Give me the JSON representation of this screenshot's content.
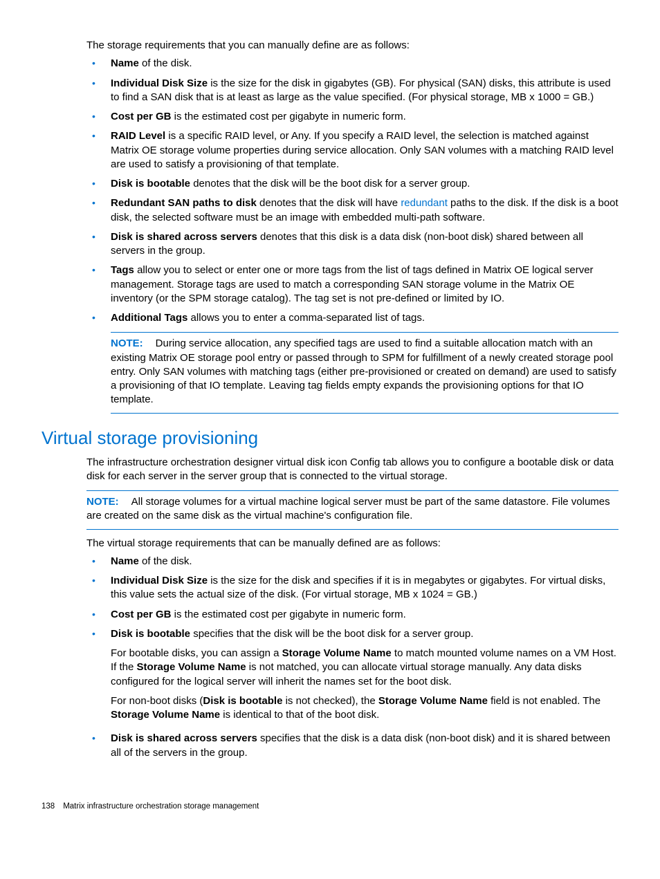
{
  "intro1": "The storage requirements that you can manually define are as follows:",
  "list1": {
    "i0_b": "Name",
    "i0_t": " of the disk.",
    "i1_b": "Individual Disk Size",
    "i1_t": " is the size for the disk in gigabytes (GB). For physical (SAN) disks, this attribute is used to find a SAN disk that is at least as large as the value specified. (For physical storage, MB x 1000 = GB.)",
    "i2_b": "Cost per GB",
    "i2_t": " is the estimated cost per gigabyte in numeric form.",
    "i3_b": "RAID Level",
    "i3_t": " is a specific RAID level, or Any. If you specify a RAID level, the selection is matched against Matrix OE storage volume properties during service allocation. Only SAN volumes with a matching RAID level are used to satisfy a provisioning of that template.",
    "i4_b": "Disk is bootable",
    "i4_t": " denotes that the disk will be the boot disk for a server group.",
    "i5_b": "Redundant SAN paths to disk",
    "i5_t1": " denotes that the disk will have ",
    "i5_link": "redundant",
    "i5_t2": " paths to the disk. If the disk is a boot disk, the selected software must be an image with embedded multi-path software.",
    "i6_b": "Disk is shared across servers",
    "i6_t": " denotes that this disk is a data disk (non-boot disk) shared between all servers in the group.",
    "i7_b": "Tags",
    "i7_t": " allow you to select or enter one or more tags from the list of tags defined in Matrix OE logical server management. Storage tags are used to match a corresponding SAN storage volume in the Matrix OE inventory (or the SPM storage catalog). The tag set is not pre-defined or limited by IO.",
    "i8_b": "Additional Tags",
    "i8_t": " allows you to enter a comma-separated list of tags."
  },
  "note1_label": "NOTE:",
  "note1_text": "During service allocation, any specified tags are used to find a suitable allocation match with an existing Matrix OE storage pool entry or passed through to SPM for fulfillment of a newly created storage pool entry. Only SAN volumes with matching tags (either pre-provisioned or created on demand) are used to satisfy a provisioning of that IO template. Leaving tag fields empty expands the provisioning options for that IO template.",
  "section_heading": "Virtual storage provisioning",
  "intro2": "The infrastructure orchestration designer virtual disk icon Config tab allows you to configure a bootable disk or data disk for each server in the server group that is connected to the virtual storage.",
  "note2_label": "NOTE:",
  "note2_text": "All storage volumes for a virtual machine logical server must be part of the same datastore. File volumes are created on the same disk as the virtual machine's configuration file.",
  "intro3": "The virtual storage requirements that can be manually defined are as follows:",
  "list2": {
    "i0_b": "Name",
    "i0_t": " of the disk.",
    "i1_b": "Individual Disk Size",
    "i1_t": " is the size for the disk and specifies if it is in megabytes or gigabytes. For virtual disks, this value sets the actual size of the disk. (For virtual storage, MB x 1024 = GB.)",
    "i2_b": "Cost per GB",
    "i2_t": " is the estimated cost per gigabyte in numeric form.",
    "i3_b": "Disk is bootable",
    "i3_t": " specifies that the disk will be the boot disk for a server group.",
    "i3_p1a": "For bootable disks, you can assign a ",
    "i3_p1b1": "Storage Volume Name",
    "i3_p1c": " to match mounted volume names on a VM Host. If the ",
    "i3_p1b2": "Storage Volume Name",
    "i3_p1d": " is not matched, you can allocate virtual storage manually. Any data disks configured for the logical server will inherit the names set for the boot disk.",
    "i3_p2a": "For non-boot disks (",
    "i3_p2b1": "Disk is bootable",
    "i3_p2c": " is not checked), the ",
    "i3_p2b2": "Storage Volume Name",
    "i3_p2d": " field is not enabled. The ",
    "i3_p2b3": "Storage Volume Name",
    "i3_p2e": " is identical to that of the boot disk.",
    "i4_b": "Disk is shared across servers",
    "i4_t": " specifies that the disk is a data disk (non-boot disk) and it is shared between all of the servers in the group."
  },
  "footer": {
    "page": "138",
    "title": "Matrix infrastructure orchestration storage management"
  }
}
